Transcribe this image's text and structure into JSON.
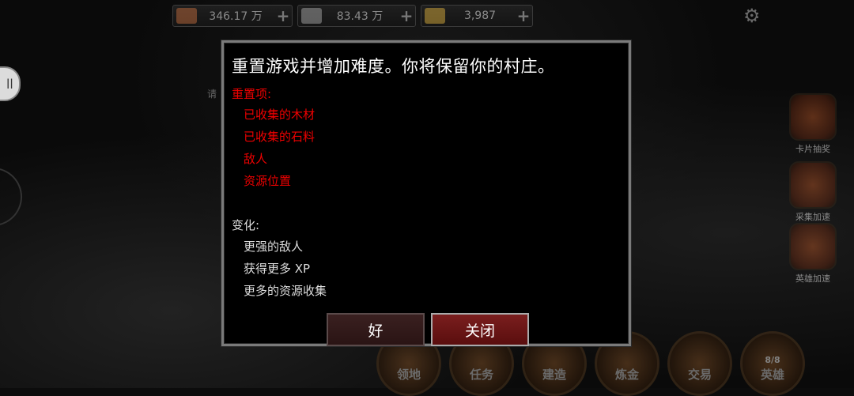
{
  "resources": [
    {
      "icon": "wood-icon",
      "value": "346.17 万",
      "color": "#b0643a"
    },
    {
      "icon": "stone-icon",
      "value": "83.43 万",
      "color": "#9a9a9a"
    },
    {
      "icon": "gold-icon",
      "value": "3,987",
      "color": "#c8a03a"
    }
  ],
  "resource_plus": "+",
  "left_button_label": "||",
  "faint_label": "请",
  "side_menu": [
    {
      "label": "卡片抽奖",
      "icon": "card-draw-icon"
    },
    {
      "label": "采集加速",
      "icon": "gather-boost-icon"
    },
    {
      "label": "英雄加速",
      "icon": "hero-boost-icon"
    }
  ],
  "nav": [
    {
      "label": "领地",
      "icon": "territory-icon",
      "sub": ""
    },
    {
      "label": "任务",
      "icon": "quest-icon",
      "sub": ""
    },
    {
      "label": "建造",
      "icon": "build-icon",
      "sub": ""
    },
    {
      "label": "炼金",
      "icon": "alchemy-icon",
      "sub": ""
    },
    {
      "label": "交易",
      "icon": "trade-icon",
      "sub": ""
    },
    {
      "label": "英雄",
      "icon": "hero-icon",
      "sub": "8/8"
    }
  ],
  "dialog": {
    "title": "重置游戏并增加难度。你将保留你的村庄。",
    "reset_heading": "重置项:",
    "reset_items": [
      "已收集的木材",
      "已收集的石料",
      "敌人",
      "资源位置"
    ],
    "change_heading": "变化:",
    "change_items": [
      "更强的敌人",
      "获得更多 XP",
      "更多的资源收集"
    ],
    "ok_label": "好",
    "close_label": "关闭"
  }
}
